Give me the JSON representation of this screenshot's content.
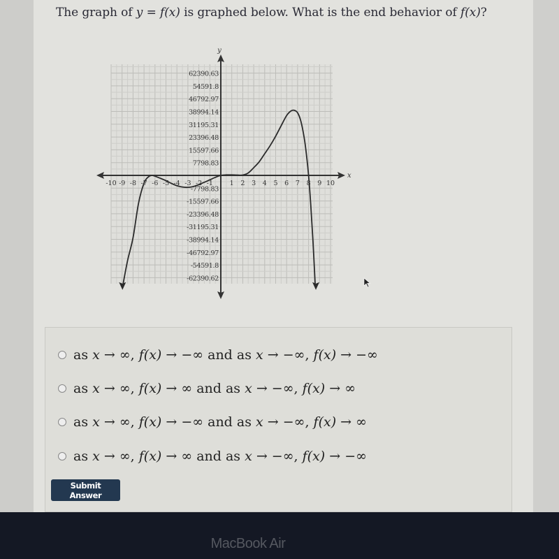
{
  "question": {
    "prefix": "The graph of ",
    "y": "y",
    "eq": " = ",
    "fx": "f(x)",
    "middle": " is graphed below. What is the end behavior of ",
    "fx2": "f(x)",
    "suffix": "?"
  },
  "chart_data": {
    "type": "line",
    "title": "",
    "xlabel": "x",
    "ylabel": "y",
    "xlim": [
      -10,
      10
    ],
    "ylim": [
      -62390.62,
      62390.63
    ],
    "grid": true,
    "x_ticks": [
      -10,
      -9,
      -8,
      -7,
      -6,
      -5,
      -4,
      -3,
      -2,
      -1,
      1,
      2,
      3,
      4,
      5,
      6,
      7,
      8,
      9,
      10
    ],
    "x_tick_labels": [
      "-10",
      "-9",
      "-8",
      "-7",
      "-6",
      "-5",
      "-4",
      "-3",
      "-2",
      "-1",
      "1",
      "2",
      "3",
      "4",
      "5",
      "6",
      "7",
      "8",
      "9",
      "10"
    ],
    "y_ticks": [
      62390.63,
      54591.8,
      46792.97,
      38994.14,
      31195.31,
      23396.48,
      15597.66,
      7798.83,
      -7798.83,
      -15597.66,
      -23396.48,
      -31195.31,
      -38994.14,
      -46792.97,
      -54591.8,
      -62390.62
    ],
    "y_tick_labels": [
      "62390.63",
      "54591.8",
      "46792.97",
      "38994.14",
      "31195.31",
      "23396.48",
      "15597.66",
      "7798.83",
      "-7798.83",
      "-15597.66",
      "-23396.48",
      "-31195.31",
      "-38994.14",
      "-46792.97",
      "-54591.8",
      "-62390.62"
    ],
    "series": [
      {
        "name": "f(x)",
        "x": [
          -8.9,
          -8.5,
          -8,
          -7.5,
          -7,
          -6.6,
          -6.3,
          -6,
          -5.5,
          -5,
          -4.5,
          -4,
          -3.5,
          -3,
          -2.5,
          -2,
          -1.5,
          -1,
          -0.5,
          0,
          0.5,
          1,
          1.5,
          2,
          2.5,
          3,
          3.5,
          4,
          4.5,
          5,
          5.5,
          6,
          6.4,
          6.7,
          7,
          7.3,
          7.6,
          7.8,
          8,
          8.2,
          8.4,
          8.6
        ],
        "y": [
          -66000,
          -52000,
          -38000,
          -17000,
          -4700,
          -900,
          0,
          -500,
          -1800,
          -3200,
          -4900,
          -6300,
          -7100,
          -7300,
          -6800,
          -5600,
          -4200,
          -2700,
          -1200,
          0,
          300,
          300,
          200,
          200,
          1500,
          4700,
          8300,
          13200,
          18200,
          23900,
          30300,
          36500,
          39300,
          39700,
          38200,
          33000,
          23000,
          13000,
          0,
          -18000,
          -40000,
          -66000
        ]
      }
    ],
    "end_arrows": [
      "left-down",
      "right-down"
    ]
  },
  "answers": [
    {
      "parts": [
        "as ",
        "x",
        " → ∞, ",
        "f(x)",
        " → −∞ and as ",
        "x",
        " → −∞, ",
        "f(x)",
        " → −∞"
      ]
    },
    {
      "parts": [
        "as ",
        "x",
        " → ∞, ",
        "f(x)",
        " → ∞ and as ",
        "x",
        " → −∞, ",
        "f(x)",
        " → ∞"
      ]
    },
    {
      "parts": [
        "as ",
        "x",
        " → ∞, ",
        "f(x)",
        " → −∞ and as ",
        "x",
        " → −∞, ",
        "f(x)",
        " → ∞"
      ]
    },
    {
      "parts": [
        "as ",
        "x",
        " → ∞, ",
        "f(x)",
        " → ∞ and as ",
        "x",
        " → −∞, ",
        "f(x)",
        " → −∞"
      ]
    }
  ],
  "submit_label": "Submit Answer",
  "device_label": "MacBook Air"
}
